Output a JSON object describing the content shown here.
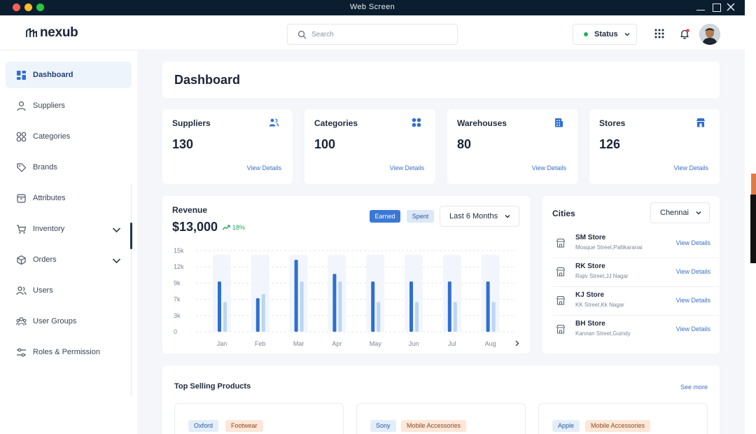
{
  "window": {
    "title": "Web Screen"
  },
  "header": {
    "logo_text": "nexub",
    "search_placeholder": "Search",
    "status_label": "Status"
  },
  "sidebar": {
    "items": [
      {
        "label": "Dashboard",
        "icon": "dashboard-icon",
        "active": true
      },
      {
        "label": "Suppliers",
        "icon": "user-icon"
      },
      {
        "label": "Categories",
        "icon": "categories-icon"
      },
      {
        "label": "Brands",
        "icon": "tag-icon"
      },
      {
        "label": "Attributes",
        "icon": "box-icon"
      },
      {
        "label": "Inventory",
        "icon": "cart-icon",
        "expandable": true
      },
      {
        "label": "Orders",
        "icon": "cube-icon",
        "expandable": true
      },
      {
        "label": "Users",
        "icon": "users-icon"
      },
      {
        "label": "User Groups",
        "icon": "user-groups-icon"
      },
      {
        "label": "Roles & Permission",
        "icon": "sliders-icon"
      }
    ]
  },
  "page": {
    "title": "Dashboard"
  },
  "stats": [
    {
      "title": "Suppliers",
      "value": "130",
      "link": "View Details",
      "icon": "users-icon"
    },
    {
      "title": "Categories",
      "value": "100",
      "link": "View Details",
      "icon": "categories-icon"
    },
    {
      "title": "Warehouses",
      "value": "80",
      "link": "View Details",
      "icon": "building-icon"
    },
    {
      "title": "Stores",
      "value": "126",
      "link": "View Details",
      "icon": "store-icon"
    }
  ],
  "revenue": {
    "label": "Revenue",
    "value": "$13,000",
    "change": "18%",
    "toggle_earned": "Earned",
    "toggle_spent": "Spent",
    "period": "Last 6 Months"
  },
  "chart_data": {
    "type": "bar",
    "categories": [
      "Jan",
      "Feb",
      "Mar",
      "Apr",
      "May",
      "Jun",
      "Jul",
      "Aug"
    ],
    "series": [
      {
        "name": "Earned",
        "values": [
          9300,
          6200,
          13300,
          10700,
          9300,
          9300,
          9300,
          9300
        ]
      },
      {
        "name": "Spent",
        "values": [
          5500,
          7000,
          9300,
          9300,
          5500,
          5500,
          5500,
          5500
        ]
      }
    ],
    "yticks": [
      "15k",
      "12k",
      "9k",
      "7k",
      "3k",
      "0"
    ],
    "ylim": [
      0,
      15000
    ],
    "grid": true,
    "colors": {
      "Earned": "#2f6fd0",
      "Spent": "#bcd5f3"
    }
  },
  "cities": {
    "title": "Cities",
    "selected": "Chennai",
    "stores": [
      {
        "name": "SM Store",
        "address": "Mosque Street,Pallikaranai",
        "link": "View Details"
      },
      {
        "name": "RK Store",
        "address": "Rajiv Street,JJ Nagar",
        "link": "View Details"
      },
      {
        "name": "KJ Store",
        "address": "KK Street,Kk Nagar",
        "link": "View Details"
      },
      {
        "name": "BH Store",
        "address": "Kannan Street,Guindy",
        "link": "View Details"
      }
    ]
  },
  "top_selling": {
    "title": "Top Selling Products",
    "see_more": "See more",
    "products": [
      {
        "brand": "Oxford",
        "category": "Footwear"
      },
      {
        "brand": "Sony",
        "category": "Mobile Accessories"
      },
      {
        "brand": "Apple",
        "category": "Mobile Accessories"
      }
    ]
  }
}
